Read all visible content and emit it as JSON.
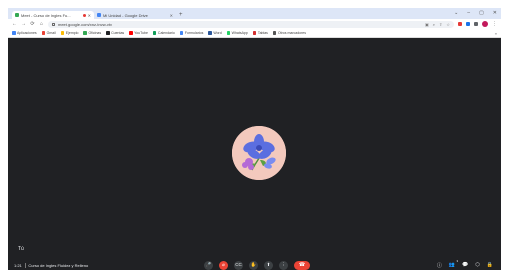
{
  "browser": {
    "tabs": [
      {
        "label": "Meet - Curso de Ingles Fu...",
        "active": true,
        "recording": true,
        "favicon_color": "#34a853"
      },
      {
        "label": "Mi Unidad - Google Drive",
        "active": false,
        "recording": false,
        "favicon_color": "#4285f4"
      }
    ],
    "new_tab_glyph": "+",
    "window_controls": [
      "⌄",
      "–",
      "▢",
      "✕"
    ],
    "url": "meet.google.com/xnz-tnvw-vtv",
    "nav_glyphs": {
      "back": "←",
      "forward": "→",
      "reload": "⟳",
      "home": "⌂"
    },
    "profile_color": "#c2185b"
  },
  "bookmarks": [
    {
      "label": "Aplicaciones",
      "color": "#4285f4"
    },
    {
      "label": "Gmail",
      "color": "#ea4335"
    },
    {
      "label": "Ejemplo",
      "color": "#fbbc05"
    },
    {
      "label": "Oficinas",
      "color": "#34a853"
    },
    {
      "label": "Cuentas",
      "color": "#202124"
    },
    {
      "label": "YouTube",
      "color": "#ff0000"
    },
    {
      "label": "Calendario",
      "color": "#0f9d58"
    },
    {
      "label": "Formularios",
      "color": "#4285f4"
    },
    {
      "label": "Word",
      "color": "#2b579a"
    },
    {
      "label": "WhatsApp",
      "color": "#25d366"
    },
    {
      "label": "Tablas",
      "color": "#d32f2f"
    },
    {
      "label": "Otros marcadores",
      "color": "#555555"
    }
  ],
  "bookmarks_more": "»",
  "meeting": {
    "background": "#202124",
    "self_label": "Tú",
    "time": "1:21",
    "title": "Curso de Ingles Fluidez y Relleno",
    "controls": [
      {
        "name": "mic",
        "glyph": "🎤",
        "red": false
      },
      {
        "name": "camera-off",
        "glyph": "⌀",
        "red": true
      },
      {
        "name": "captions",
        "glyph": "CC",
        "red": false
      },
      {
        "name": "raise-hand",
        "glyph": "✋",
        "red": false
      },
      {
        "name": "present",
        "glyph": "⬆",
        "red": false
      },
      {
        "name": "more",
        "glyph": "⋮",
        "red": false
      }
    ],
    "hangup_glyph": "☎",
    "right_controls": [
      {
        "name": "info",
        "glyph": "ⓘ"
      },
      {
        "name": "people",
        "glyph": "👥",
        "count": "3"
      },
      {
        "name": "chat",
        "glyph": "💬"
      },
      {
        "name": "activities",
        "glyph": "⬡"
      },
      {
        "name": "host",
        "glyph": "🔒"
      }
    ]
  }
}
